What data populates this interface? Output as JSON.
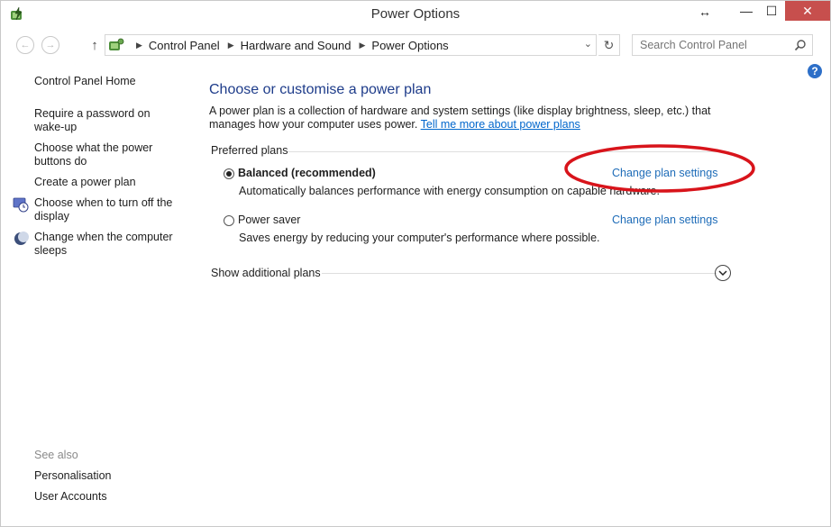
{
  "window": {
    "title": "Power Options",
    "resize_glyph": "↔",
    "controls": {
      "minimize": "—",
      "maximize": "☐",
      "close": "✕"
    }
  },
  "navbar": {
    "breadcrumbs": [
      "Control Panel",
      "Hardware and Sound",
      "Power Options"
    ],
    "search_placeholder": "Search Control Panel",
    "help_label": "?"
  },
  "sidebar": {
    "home": "Control Panel Home",
    "links": [
      "Require a password on wake-up",
      "Choose what the power buttons do",
      "Create a power plan",
      "Choose when to turn off the display",
      "Change when the computer sleeps"
    ],
    "see_also_label": "See also",
    "see_also": [
      "Personalisation",
      "User Accounts"
    ]
  },
  "main": {
    "heading": "Choose or customise a power plan",
    "description": "A power plan is a collection of hardware and system settings (like display brightness, sleep, etc.) that manages how your computer uses power.",
    "description_link": "Tell me more about power plans",
    "preferred_label": "Preferred plans",
    "plans": [
      {
        "name": "Balanced (recommended)",
        "description": "Automatically balances performance with energy consumption on capable hardware.",
        "link": "Change plan settings",
        "selected": true
      },
      {
        "name": "Power saver",
        "description": "Saves energy by reducing your computer's performance where possible.",
        "link": "Change plan settings",
        "selected": false
      }
    ],
    "more_label": "Show additional plans"
  },
  "colors": {
    "heading": "#1e3c8a",
    "link": "#1e6cb8",
    "close_button": "#c74f4d",
    "annotation": "#d8141b"
  }
}
